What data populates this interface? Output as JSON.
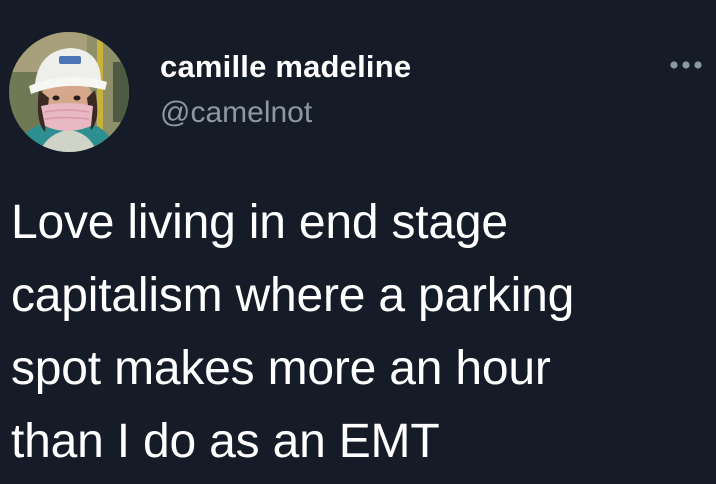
{
  "tweet": {
    "display_name": "camille madeline",
    "handle": "@camelnot",
    "text_lines": [
      "Love living in end stage",
      "capitalism where a parking",
      "spot makes more an hour",
      "than I do as an EMT"
    ]
  },
  "icons": {
    "avatar": "profile-photo",
    "more": "more-options-icon"
  },
  "colors": {
    "background": "#151c27",
    "text": "#ffffff",
    "secondary_text": "#8b98a5"
  }
}
